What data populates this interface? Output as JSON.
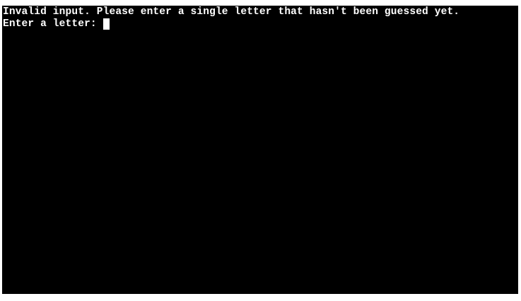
{
  "terminal": {
    "lines": [
      "Invalid input. Please enter a single letter that hasn't been guessed yet."
    ],
    "prompt": "Enter a letter: ",
    "input_value": "",
    "colors": {
      "background": "#000000",
      "foreground": "#ffffff"
    }
  }
}
